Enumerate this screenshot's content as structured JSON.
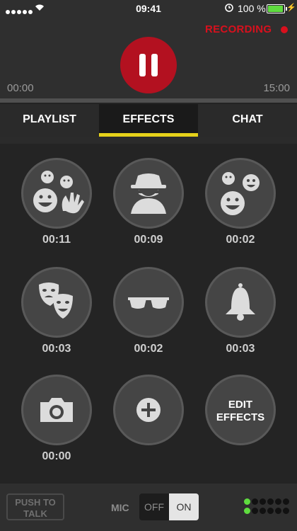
{
  "status_bar": {
    "time": "09:41",
    "battery": "100 %"
  },
  "recorder": {
    "recording_label": "RECORDING",
    "time_start": "00:00",
    "time_end": "15:00",
    "progress": 0.0
  },
  "tabs": [
    {
      "label": "PLAYLIST",
      "active": false
    },
    {
      "label": "EFFECTS",
      "active": true
    },
    {
      "label": "CHAT",
      "active": false
    }
  ],
  "effects": [
    {
      "icon": "crowd-laugh-icon",
      "duration": "00:11"
    },
    {
      "icon": "spy-icon",
      "duration": "00:09"
    },
    {
      "icon": "smileys-icon",
      "duration": "00:02"
    },
    {
      "icon": "theater-masks-icon",
      "duration": "00:03"
    },
    {
      "icon": "sunglasses-icon",
      "duration": "00:02"
    },
    {
      "icon": "bell-icon",
      "duration": "00:03"
    },
    {
      "icon": "camera-icon",
      "duration": "00:00"
    },
    {
      "icon": "plus-icon",
      "duration": ""
    },
    {
      "icon": "edit-effects",
      "label_line1": "EDIT",
      "label_line2": "EFFECTS"
    }
  ],
  "bottom_bar": {
    "push_to_talk_line1": "PUSH TO",
    "push_to_talk_line2": "TALK",
    "mic_label": "MIC",
    "mic_off": "OFF",
    "mic_on": "ON",
    "mic_state": "ON"
  },
  "colors": {
    "accent": "#e6d21a",
    "record": "#d8101d",
    "level_on": "#5fdc3f"
  }
}
